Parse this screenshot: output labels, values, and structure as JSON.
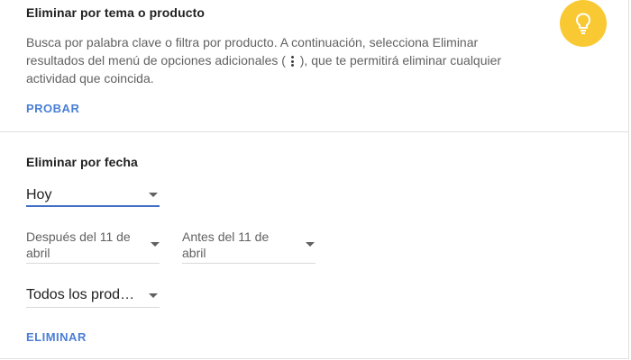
{
  "topic_section": {
    "title": "Eliminar por tema o producto",
    "description_before": "Busca por palabra clave o filtra por producto. A continuación, selecciona Eliminar resultados del menú de opciones adicionales ( ",
    "description_after": " ), que te permitirá eliminar cualquier actividad que coincida.",
    "action_label": "PROBAR",
    "bulb_color": "#f9c934"
  },
  "date_section": {
    "title": "Eliminar por fecha",
    "range_select": {
      "value": "Hoy"
    },
    "after_select": {
      "value": "Después del 11 de abril"
    },
    "before_select": {
      "value": "Antes del 11 de abril"
    },
    "product_select": {
      "value": "Todos los prod…"
    },
    "action_label": "ELIMINAR"
  },
  "colors": {
    "accent": "#4a7fd6",
    "active_underline": "#3f6fc6"
  }
}
